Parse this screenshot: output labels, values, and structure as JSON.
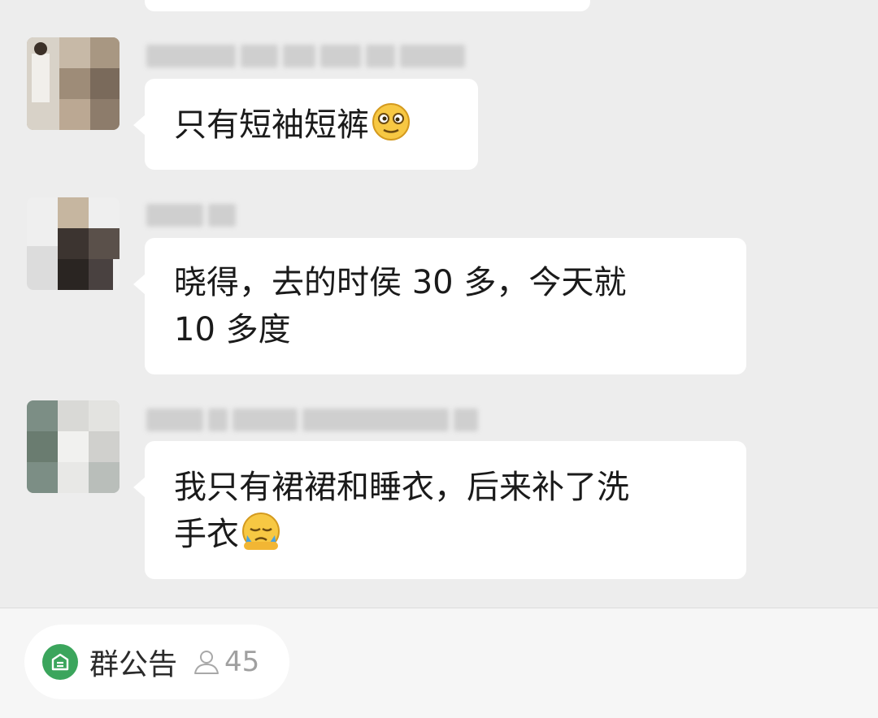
{
  "messages": [
    {
      "text": ""
    },
    {
      "text": "只有短袖短裤",
      "emoji": "dizzy-face-emoji"
    },
    {
      "line1": "晓得，去的时侯 30 多，今天就",
      "line2": "10 多度"
    },
    {
      "line1": "我只有裙裙和睡衣，后来补了洗",
      "line2": "手衣",
      "emoji": "facepalm-emoji"
    }
  ],
  "footer": {
    "announcement_label": "群公告",
    "member_count": "45"
  },
  "colors": {
    "background": "#ededed",
    "bubble": "#ffffff",
    "accent_green": "#3ba55c"
  }
}
